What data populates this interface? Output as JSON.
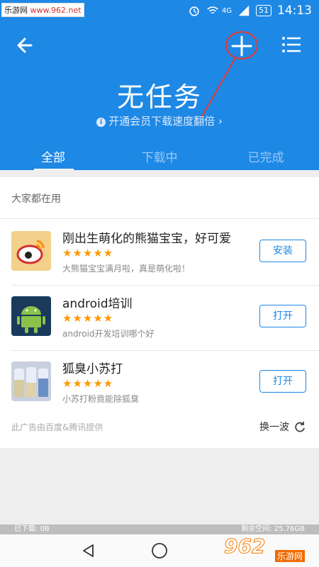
{
  "watermark_top": {
    "prefix": "乐游网",
    "url": "www.962.net"
  },
  "status": {
    "network": "4G",
    "battery": "51",
    "time": "14:13"
  },
  "header": {
    "title": "无任务",
    "subtitle": "开通会员下载速度翻倍",
    "subtitle_arrow": "›"
  },
  "tabs": [
    {
      "label": "全部"
    },
    {
      "label": "下载中"
    },
    {
      "label": "已完成"
    }
  ],
  "section": {
    "title": "大家都在用"
  },
  "apps": [
    {
      "name": "刚出生萌化的熊猫宝宝，好可爱",
      "rating": 5,
      "stars": "★★★★★",
      "desc": "大熊猫宝宝满月啦，真是萌化啦！",
      "button": "安装",
      "icon": "weibo-icon"
    },
    {
      "name": "android培训",
      "rating": 4.5,
      "stars": "★★★★★",
      "desc": "android开发培训哪个好",
      "button": "打开",
      "icon": "android-icon"
    },
    {
      "name": "狐臭小苏打",
      "rating": 4.5,
      "stars": "★★★★★",
      "desc": "小苏打粉竟能除狐臭",
      "button": "打开",
      "icon": "bottles-icon"
    }
  ],
  "ad_note": "此广告由百度&腾讯提供",
  "refresh_label": "换一波",
  "storage": {
    "downloaded": "已下载: 0B",
    "remaining": "剩余空间: 25.76GB"
  },
  "watermark_bottom": {
    "logo": "962",
    "text": "乐游网"
  },
  "colors": {
    "primary": "#1e88e5",
    "star": "#ff9800",
    "annotation": "#e53935"
  }
}
